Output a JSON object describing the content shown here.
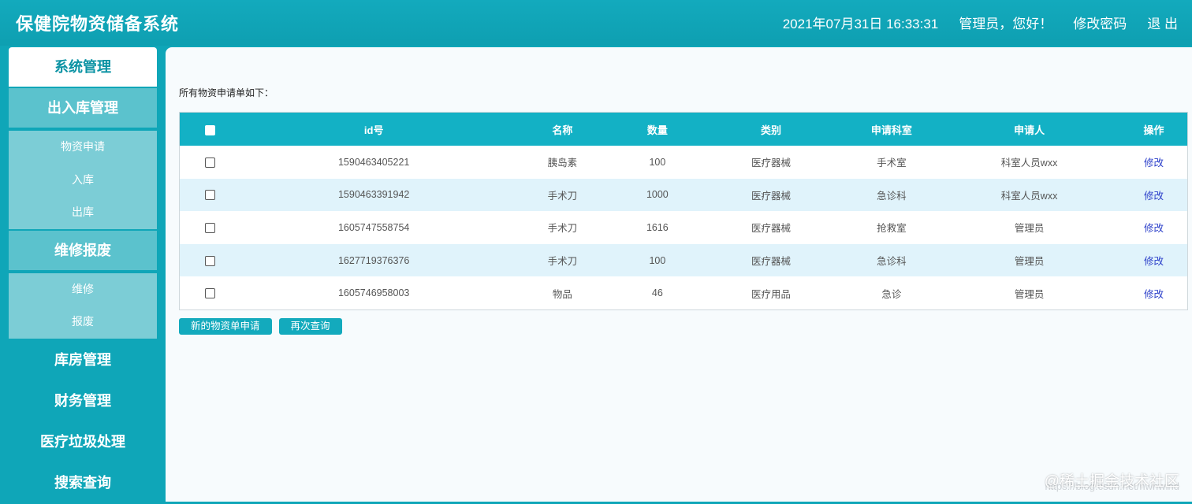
{
  "header": {
    "title": "保健院物资储备系统",
    "datetime": "2021年07月31日 16:33:31",
    "greeting": "管理员，您好！",
    "change_password": "修改密码",
    "logout": "退 出"
  },
  "sidebar": {
    "items": [
      {
        "label": "系统管理",
        "active": true
      },
      {
        "label": "出入库管理"
      },
      {
        "label": "物资申请"
      },
      {
        "label": "入库"
      },
      {
        "label": "出库"
      },
      {
        "label": "维修报废"
      },
      {
        "label": "维修"
      },
      {
        "label": "报废"
      },
      {
        "label": "库房管理"
      },
      {
        "label": "财务管理"
      },
      {
        "label": "医疗垃圾处理"
      },
      {
        "label": "搜索查询"
      }
    ]
  },
  "main": {
    "intro": "所有物资申请单如下：",
    "columns": [
      "id号",
      "名称",
      "数量",
      "类别",
      "申请科室",
      "申请人",
      "操作"
    ],
    "rows": [
      {
        "id": "1590463405221",
        "name": "胰岛素",
        "qty": "100",
        "category": "医疗器械",
        "dept": "手术室",
        "applicant": "科室人员wxx",
        "op": "修改"
      },
      {
        "id": "1590463391942",
        "name": "手术刀",
        "qty": "1000",
        "category": "医疗器械",
        "dept": "急诊科",
        "applicant": "科室人员wxx",
        "op": "修改"
      },
      {
        "id": "1605747558754",
        "name": "手术刀",
        "qty": "1616",
        "category": "医疗器械",
        "dept": "抢救室",
        "applicant": "管理员",
        "op": "修改"
      },
      {
        "id": "1627719376376",
        "name": "手术刀",
        "qty": "100",
        "category": "医疗器械",
        "dept": "急诊科",
        "applicant": "管理员",
        "op": "修改"
      },
      {
        "id": "1605746958003",
        "name": "物品",
        "qty": "46",
        "category": "医疗用品",
        "dept": "急诊",
        "applicant": "管理员",
        "op": "修改"
      }
    ],
    "buttons": {
      "new_request": "新的物资单申请",
      "query_again": "再次查询"
    }
  },
  "watermark": {
    "text": "@稀土掘金技术社区",
    "url": "https://blog.csdn.net/nwnwind"
  },
  "colors": {
    "primary": "#0fa6b8",
    "table_header": "#13b1c5",
    "row_alt": "#e0f3fb",
    "link": "#2a3ec9"
  }
}
